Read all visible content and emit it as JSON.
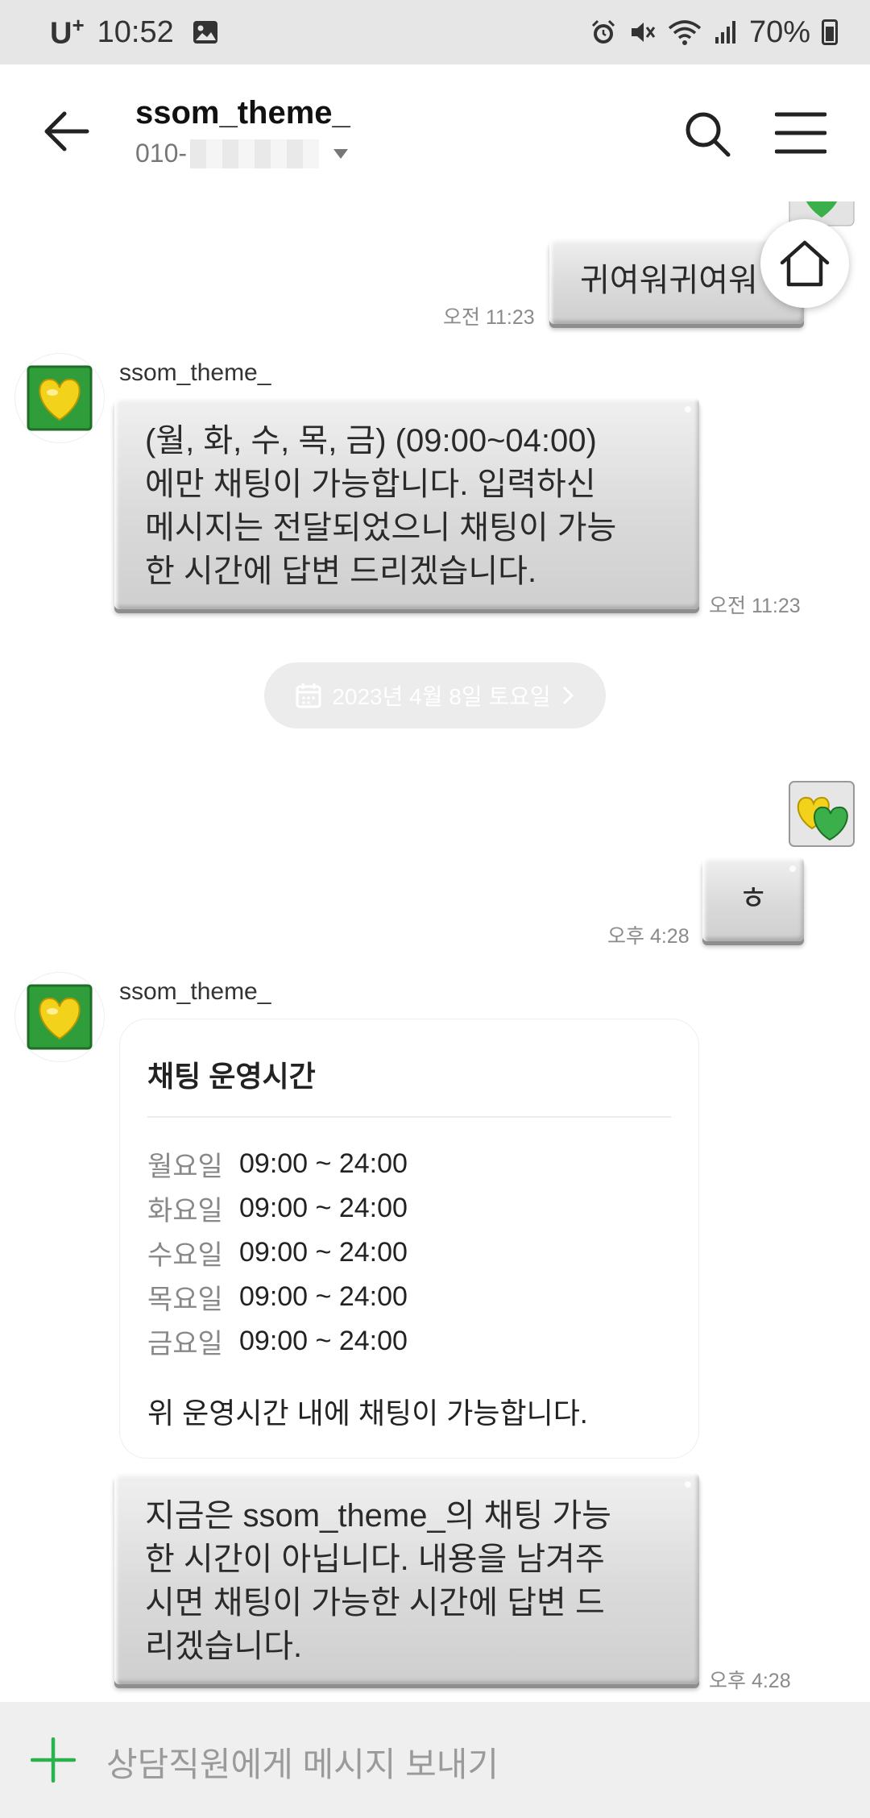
{
  "status_bar": {
    "carrier": "U",
    "carrier_sup": "+",
    "time": "10:52",
    "battery": "70%",
    "icons": [
      "image-icon",
      "alarm-icon",
      "vibrate-mute-icon",
      "wifi-icon",
      "signal-icon",
      "battery-icon"
    ]
  },
  "header": {
    "title": "ssom_theme_",
    "phone_prefix": "010-",
    "back_icon": "arrow-left-icon",
    "search_icon": "search-icon",
    "menu_icon": "hamburger-menu-icon"
  },
  "messages": {
    "m1": {
      "text": "귀여워귀여워",
      "time": "오전 11:23"
    },
    "m2": {
      "sender": "ssom_theme_",
      "lines": [
        "(월, 화, 수, 목, 금) (09:00~04:00)",
        "에만 채팅이 가능합니다. 입력하신",
        "메시지는 전달되었으니 채팅이 가능",
        "한 시간에 답변 드리겠습니다."
      ],
      "time": "오전 11:23"
    },
    "date_divider": "2023년 4월 8일 토요일",
    "m3": {
      "text": "ㅎ",
      "time": "오후 4:28"
    },
    "m4": {
      "sender": "ssom_theme_"
    },
    "card": {
      "title": "채팅 운영시간",
      "hours": [
        {
          "day": "월요일",
          "time": "09:00 ~ 24:00"
        },
        {
          "day": "화요일",
          "time": "09:00 ~ 24:00"
        },
        {
          "day": "수요일",
          "time": "09:00 ~ 24:00"
        },
        {
          "day": "목요일",
          "time": "09:00 ~ 24:00"
        },
        {
          "day": "금요일",
          "time": "09:00 ~ 24:00"
        }
      ],
      "note": "위 운영시간 내에 채팅이 가능합니다."
    },
    "m5": {
      "lines": [
        "지금은 ssom_theme_의 채팅 가능",
        "한 시간이 아닙니다. 내용을 남겨주",
        "시면 채팅이 가능한 시간에 답변 드",
        "리겠습니다."
      ],
      "time": "오후 4:28"
    }
  },
  "input": {
    "placeholder": "상담직원에게 메시지 보내기",
    "plus_icon": "plus-icon"
  },
  "floating": {
    "home_icon": "home-icon"
  },
  "colors": {
    "accent_green": "#2bb24c",
    "bubble_gray": "#d9d9d9",
    "input_bar": "#efefef"
  }
}
